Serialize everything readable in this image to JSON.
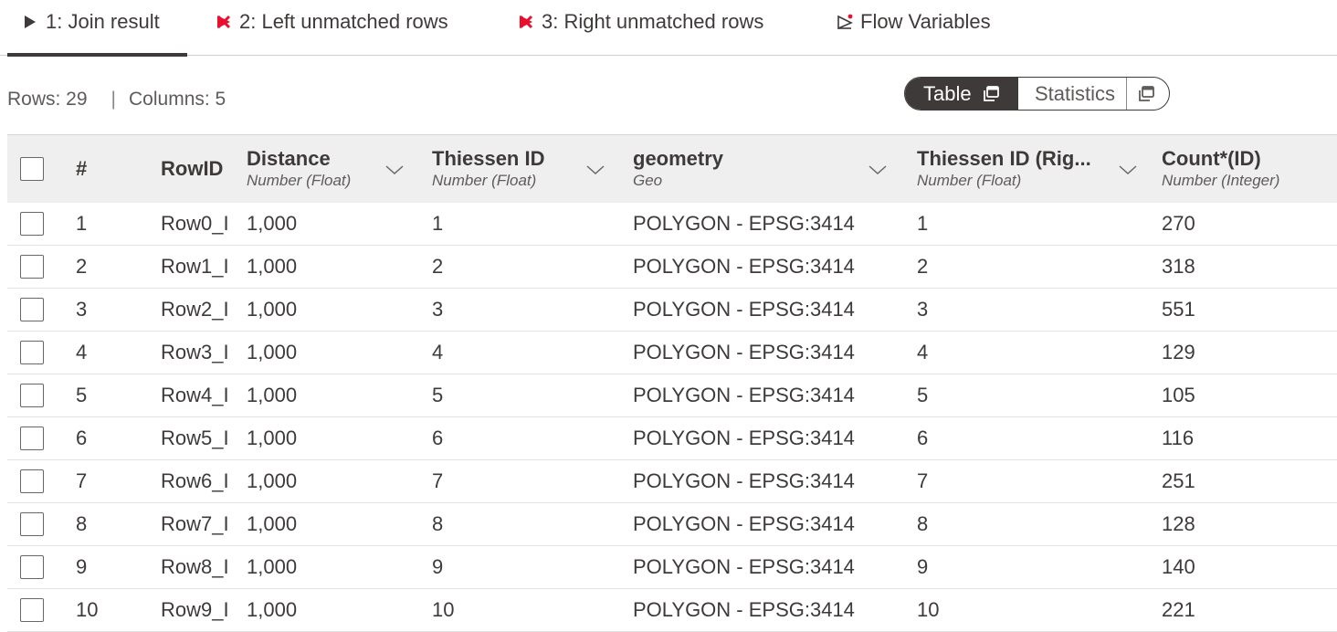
{
  "tabs": [
    {
      "label": "1: Join result",
      "icon": "play-icon",
      "active": true
    },
    {
      "label": "2: Left unmatched rows",
      "icon": "inactive-port-icon",
      "active": false
    },
    {
      "label": "3: Right unmatched rows",
      "icon": "inactive-port-icon",
      "active": false
    },
    {
      "label": "Flow Variables",
      "icon": "flow-variable-icon",
      "active": false
    }
  ],
  "info": {
    "rows_label": "Rows: 29",
    "separator": "|",
    "columns_label": "Columns: 5"
  },
  "view_switch": {
    "table_label": "Table",
    "statistics_label": "Statistics"
  },
  "table": {
    "columns": [
      {
        "title": "#",
        "type": ""
      },
      {
        "title": "RowID",
        "type": ""
      },
      {
        "title": "Distance",
        "type": "Number (Float)"
      },
      {
        "title": "Thiessen ID",
        "type": "Number (Float)"
      },
      {
        "title": "geometry",
        "type": "Geo"
      },
      {
        "title": "Thiessen ID (Rig...",
        "type": "Number (Float)"
      },
      {
        "title": "Count*(ID)",
        "type": "Number (Integer)"
      }
    ],
    "rows": [
      {
        "num": "1",
        "rowid": "Row0_I",
        "distance": "1,000",
        "tid": "1",
        "geometry": "POLYGON - EPSG:3414",
        "tid_right": "1",
        "count": "270"
      },
      {
        "num": "2",
        "rowid": "Row1_I",
        "distance": "1,000",
        "tid": "2",
        "geometry": "POLYGON - EPSG:3414",
        "tid_right": "2",
        "count": "318"
      },
      {
        "num": "3",
        "rowid": "Row2_I",
        "distance": "1,000",
        "tid": "3",
        "geometry": "POLYGON - EPSG:3414",
        "tid_right": "3",
        "count": "551"
      },
      {
        "num": "4",
        "rowid": "Row3_I",
        "distance": "1,000",
        "tid": "4",
        "geometry": "POLYGON - EPSG:3414",
        "tid_right": "4",
        "count": "129"
      },
      {
        "num": "5",
        "rowid": "Row4_I",
        "distance": "1,000",
        "tid": "5",
        "geometry": "POLYGON - EPSG:3414",
        "tid_right": "5",
        "count": "105"
      },
      {
        "num": "6",
        "rowid": "Row5_I",
        "distance": "1,000",
        "tid": "6",
        "geometry": "POLYGON - EPSG:3414",
        "tid_right": "6",
        "count": "116"
      },
      {
        "num": "7",
        "rowid": "Row6_I",
        "distance": "1,000",
        "tid": "7",
        "geometry": "POLYGON - EPSG:3414",
        "tid_right": "7",
        "count": "251"
      },
      {
        "num": "8",
        "rowid": "Row7_I",
        "distance": "1,000",
        "tid": "8",
        "geometry": "POLYGON - EPSG:3414",
        "tid_right": "8",
        "count": "128"
      },
      {
        "num": "9",
        "rowid": "Row8_I",
        "distance": "1,000",
        "tid": "9",
        "geometry": "POLYGON - EPSG:3414",
        "tid_right": "9",
        "count": "140"
      },
      {
        "num": "10",
        "rowid": "Row9_I",
        "distance": "1,000",
        "tid": "10",
        "geometry": "POLYGON - EPSG:3414",
        "tid_right": "10",
        "count": "221"
      }
    ]
  },
  "colors": {
    "text": "#3e3a39",
    "inactive_port": "#e8102e",
    "header_bg": "#f0efef"
  }
}
